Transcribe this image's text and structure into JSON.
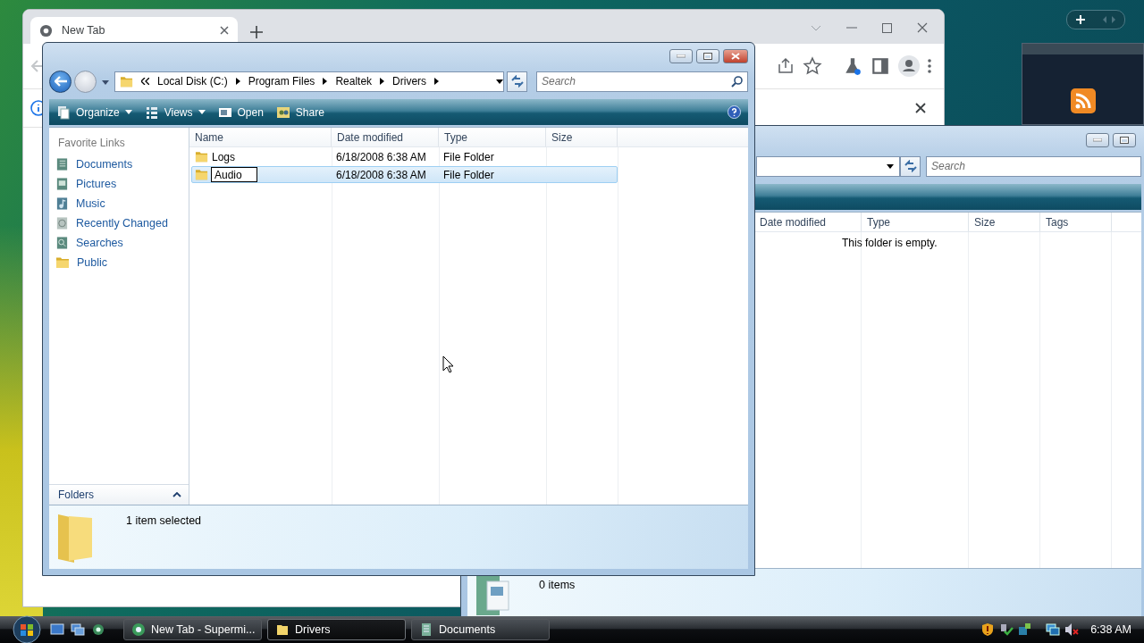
{
  "browser": {
    "tabs": [
      {
        "title": "New Tab",
        "selected": true
      }
    ]
  },
  "drivers_window": {
    "breadcrumb": [
      "Local Disk (C:)",
      "Program Files",
      "Realtek",
      "Drivers"
    ],
    "search": {
      "placeholder": "Search"
    },
    "toolbar": [
      {
        "label": "Organize",
        "kind": "organize"
      },
      {
        "label": "Views",
        "kind": "views"
      },
      {
        "label": "Open",
        "kind": "open"
      },
      {
        "label": "Share",
        "kind": "share"
      }
    ],
    "favorite_links": {
      "title": "Favorite Links",
      "items": [
        {
          "label": "Documents",
          "kind": "documents"
        },
        {
          "label": "Pictures",
          "kind": "pictures"
        },
        {
          "label": "Music",
          "kind": "music"
        },
        {
          "label": "Recently Changed",
          "kind": "recent"
        },
        {
          "label": "Searches",
          "kind": "searches"
        },
        {
          "label": "Public",
          "kind": "folder"
        }
      ]
    },
    "columns": [
      "Name",
      "Date modified",
      "Type",
      "Size"
    ],
    "rows": [
      {
        "name": "Logs",
        "date_modified": "6/18/2008 6:38 AM",
        "type": "File Folder",
        "selected": false,
        "editing": false
      },
      {
        "name": "Audio",
        "date_modified": "6/18/2008 6:38 AM",
        "type": "File Folder",
        "selected": true,
        "editing": true
      }
    ],
    "folders_label": "Folders",
    "status": "1 item selected"
  },
  "documents_window": {
    "search": {
      "placeholder": "Search"
    },
    "columns": [
      "Date modified",
      "Type",
      "Size",
      "Tags"
    ],
    "empty_message": "This folder is empty.",
    "status": "0 items"
  },
  "taskbar": {
    "buttons": [
      {
        "label": "New Tab - Supermi...",
        "kind": "browser",
        "selected": false
      },
      {
        "label": "Drivers",
        "kind": "folder",
        "selected": true
      },
      {
        "label": "Documents",
        "kind": "documents",
        "selected": false
      }
    ],
    "clock": "6:38 AM"
  }
}
